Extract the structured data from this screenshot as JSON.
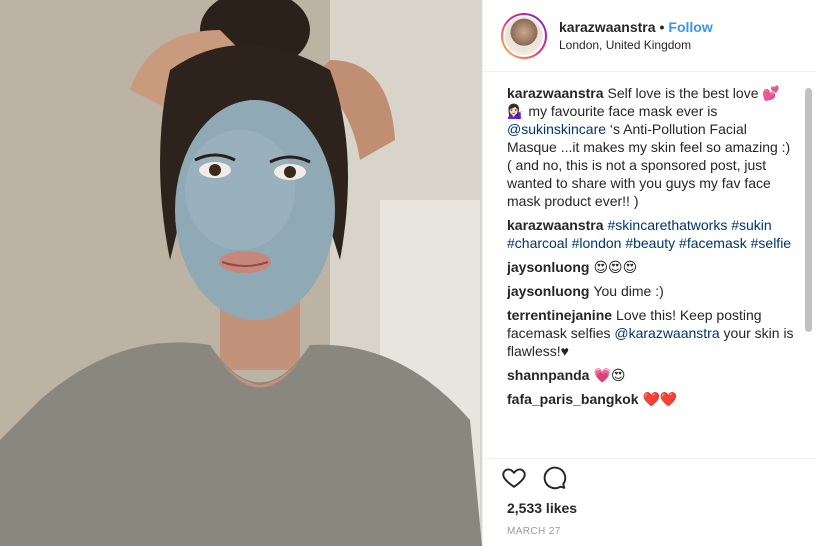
{
  "header": {
    "username": "karazwaanstra",
    "separator": "•",
    "follow_label": "Follow",
    "location": "London, United Kingdom"
  },
  "caption": {
    "username": "karazwaanstra",
    "text_part1": "Self love is the best love 💕 💁🏻‍♀️ my favourite face mask ever is ",
    "mention": "@sukinskincare",
    "text_part2": " ‘s Anti-Pollution Facial Masque ...it makes my skin feel so amazing :) ( and no, this is not a sponsored post, just wanted to share with you guys my fav face mask product ever!! )"
  },
  "comments": [
    {
      "username": "karazwaanstra",
      "tags": [
        "#skincarethatworks",
        "#sukin",
        "#charcoal",
        "#london",
        "#beauty",
        "#facemask",
        "#selfie"
      ]
    },
    {
      "username": "jaysonluong",
      "text": "😍😍😍"
    },
    {
      "username": "jaysonluong",
      "text": "You dime :)"
    },
    {
      "username": "terrentinejanine",
      "text_part1": "Love this! Keep posting facemask selfies ",
      "mention": "@karazwaanstra",
      "text_part2": " your skin is flawless!♥"
    },
    {
      "username": "shannpanda",
      "text": "💗😍"
    },
    {
      "username": "fafa_paris_bangkok",
      "text": "❤️❤️"
    }
  ],
  "likes": "2,533 likes",
  "date": "MARCH 27",
  "icons": {
    "like": "heart-icon",
    "comment": "comment-icon"
  },
  "colors": {
    "link": "#003569",
    "follow": "#3897f0",
    "mask": "#8fa9b5"
  }
}
